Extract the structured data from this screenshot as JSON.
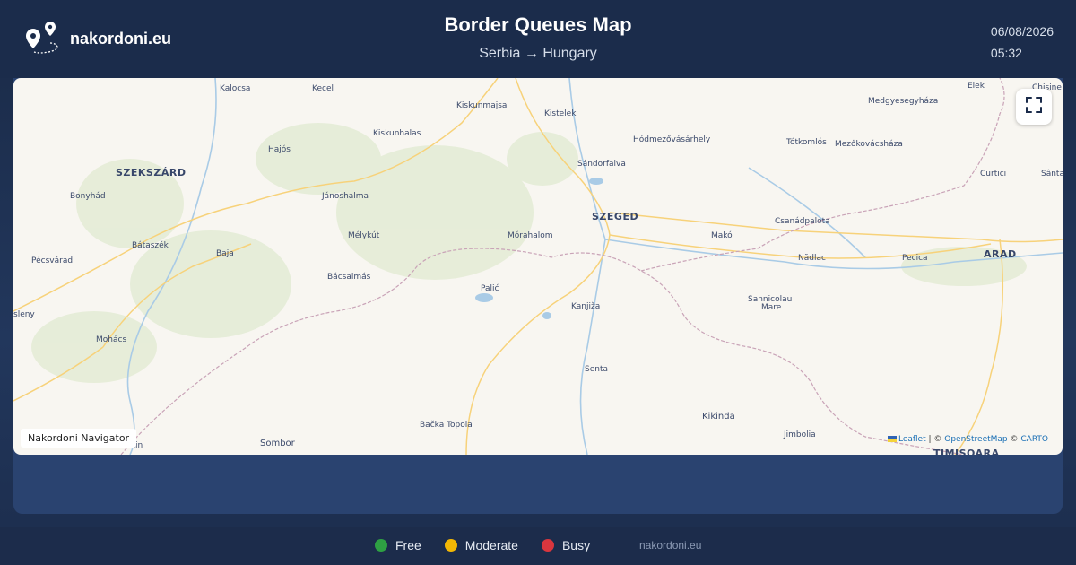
{
  "header": {
    "brand": "nakordoni.eu",
    "title": "Border Queues Map",
    "route": "Serbia → Hungary",
    "date": "06/08/2026",
    "time": "05:32"
  },
  "map": {
    "cities": {
      "kalocsa": "Kalocsa",
      "kecel": "Kecel",
      "kiskunmajsa": "Kiskunmajsa",
      "kistelek": "Kistelek",
      "elek": "Elek",
      "chisineu": "Chișine",
      "medgyesegyhaza": "Medgyesegyháza",
      "kiskunhalas": "Kiskunhalas",
      "hodmezovasarhely": "Hódmezővásárhely",
      "totkomlos": "Tótkomlós",
      "mezokovacshaza": "Mezőkovácsháza",
      "hajos": "Hajós",
      "szekszard": "SZEKSZÁRD",
      "sandorfalva": "Sándorfalva",
      "curtici": "Curtici",
      "santa": "Sânta",
      "bonyhad": "Bonyhád",
      "janoshalma": "Jánoshalma",
      "szeged": "SZEGED",
      "csanadpalota": "Csanádpalota",
      "melykut": "Mélykút",
      "morahalom": "Mórahalom",
      "mako": "Makó",
      "bataszek": "Bátaszék",
      "baja": "Baja",
      "nadlac": "Nădlac",
      "pecica": "Pecica",
      "arad": "ARAD",
      "pecsvarad": "Pécsvárad",
      "bacsalmas": "Bácsalmás",
      "palic": "Palić",
      "sannicolau": "Sannicolau",
      "mare": "Mare",
      "kanjiza": "Kanjiža",
      "sleny": "sleny",
      "mohacs": "Mohács",
      "senta": "Senta",
      "backatopola": "Bačka Topola",
      "kikinda": "Kikinda",
      "sombor": "Sombor",
      "jimbolia": "Jimbolia",
      "timisoara": "TIMIȘOARA",
      "apatin": "atin"
    },
    "nav_label": "Nakordoni Navigator",
    "attribution": {
      "leaflet": "Leaflet",
      "sep1": " | © ",
      "osm": "OpenStreetMap",
      "sep2": " © ",
      "carto": "CARTO"
    },
    "fullscreen_icon": "fullscreen-icon"
  },
  "legend": [
    {
      "label": "Free",
      "color": "#2ea043"
    },
    {
      "label": "Moderate",
      "color": "#f2b705"
    },
    {
      "label": "Busy",
      "color": "#d9363e"
    }
  ],
  "footer": {
    "site": "nakordoni.eu"
  },
  "colors": {
    "background": "#1b2c4b",
    "map_land": "#f8f6f1",
    "road": "#f7d27a",
    "water": "#a9cbe6",
    "border": "#c9a3b7"
  }
}
